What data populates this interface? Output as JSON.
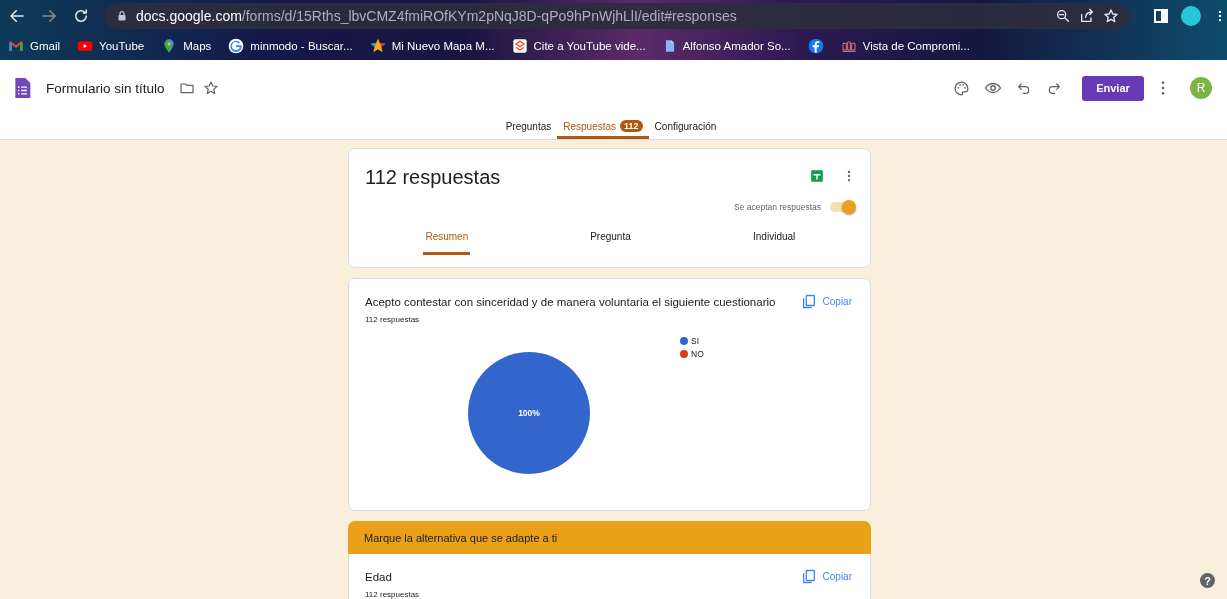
{
  "browser": {
    "url_host": "docs.google.com",
    "url_path": "/forms/d/15Rths_lbvCMZ4fmiROfKYm2pNqJ8D-qPo9hPnWjhLlI/edit#responses",
    "bookmarks": [
      {
        "kind": "mail",
        "label": "Gmail"
      },
      {
        "kind": "video",
        "label": "YouTube"
      },
      {
        "kind": "pin",
        "label": "Maps"
      },
      {
        "kind": "search",
        "label": "minmodo - Buscar..."
      },
      {
        "kind": "star",
        "label": "Mi Nuevo Mapa M..."
      },
      {
        "kind": "cite",
        "label": "Cite a YouTube vide..."
      },
      {
        "kind": "doc",
        "label": "Alfonso Amador So..."
      },
      {
        "kind": "social"
      },
      {
        "kind": "crest",
        "label": "Vista de Compromi..."
      }
    ]
  },
  "app": {
    "title": "Formulario sin título",
    "send_button": "Enviar",
    "avatar": "R",
    "tabs": [
      {
        "label": "Preguntas",
        "selected": false
      },
      {
        "label": "Respuestas",
        "badge": "112",
        "selected": true
      },
      {
        "label": "Configuración",
        "selected": false
      }
    ]
  },
  "summary": {
    "title": "112 respuestas",
    "accepting": {
      "label": "Se aceptan respuestas",
      "on": true
    },
    "views": [
      {
        "label": "Resumen",
        "selected": true
      },
      {
        "label": "Pregunta",
        "selected": false
      },
      {
        "label": "Individual",
        "selected": false
      }
    ]
  },
  "items": [
    {
      "kind": "question",
      "title": "Acepto contestar con sinceridad y de manera voluntaria el siguiente cuestionario",
      "count": "112 respuestas",
      "copy": "Copiar",
      "legend": [
        {
          "color": "#3366cc"
        },
        {
          "color": "#dc3912"
        }
      ],
      "chart_data": {
        "type": "pie",
        "categories": [
          "SI",
          "NO"
        ],
        "values": [
          100,
          0
        ],
        "value_labels": [
          "100%",
          null
        ]
      }
    },
    {
      "kind": "section",
      "title": "Marque la alternativa que se adapte a ti"
    },
    {
      "kind": "question",
      "title": "Edad",
      "count": "112 respuestas",
      "copy": "Copiar"
    }
  ],
  "help": "?"
}
